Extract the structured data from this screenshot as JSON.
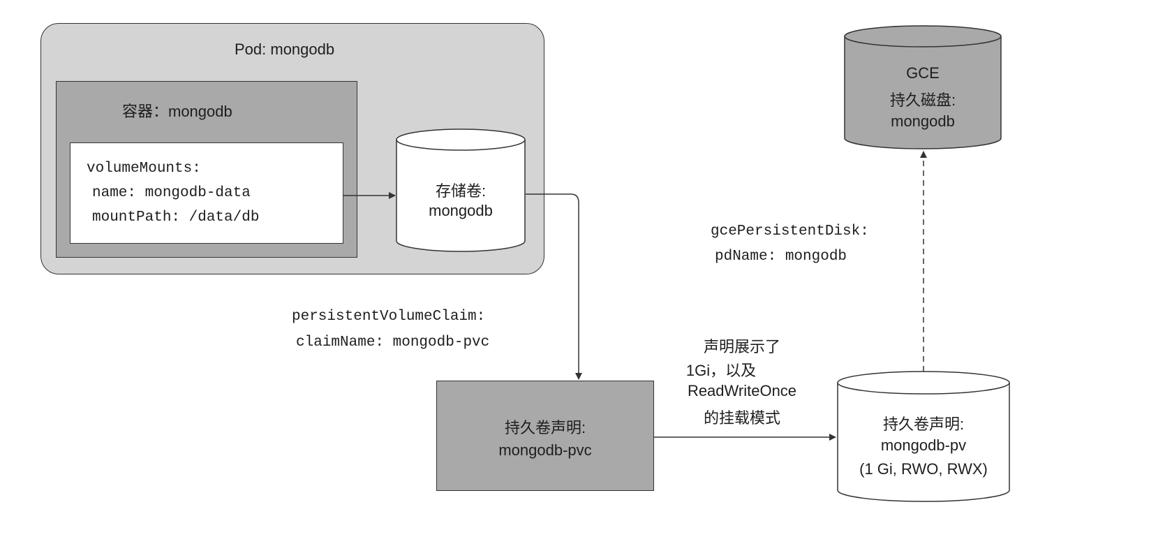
{
  "pod": {
    "title": "Pod: mongodb"
  },
  "container": {
    "title": "容器：mongodb",
    "volume_mounts": [
      "volumeMounts:",
      "  name: mongodb-data",
      "  mountPath: /data/db"
    ]
  },
  "storage_volume": {
    "lines": [
      "存储卷:",
      "mongodb"
    ]
  },
  "pvc_reference": [
    "persistentVolumeClaim:",
    "  claimName: mongodb-pvc"
  ],
  "pvc": {
    "lines": [
      "持久卷声明:",
      "mongodb-pvc"
    ]
  },
  "binding_note": [
    "声明展示了",
    "1Gi，以及",
    "ReadWriteOnce",
    "的挂载模式"
  ],
  "pv": {
    "lines": [
      "持久卷声明:",
      "mongodb-pv",
      "(1 Gi, RWO, RWX)"
    ]
  },
  "gce_reference": [
    "gcePersistentDisk:",
    "  pdName: mongodb"
  ],
  "gce_disk": {
    "lines": [
      "GCE",
      "持久磁盘:",
      "mongodb"
    ]
  },
  "colors": {
    "pod_fill": "#d4d4d4",
    "dark_fill": "#a9a9a9",
    "light_fill": "#ffffff",
    "stroke": "#333333"
  }
}
